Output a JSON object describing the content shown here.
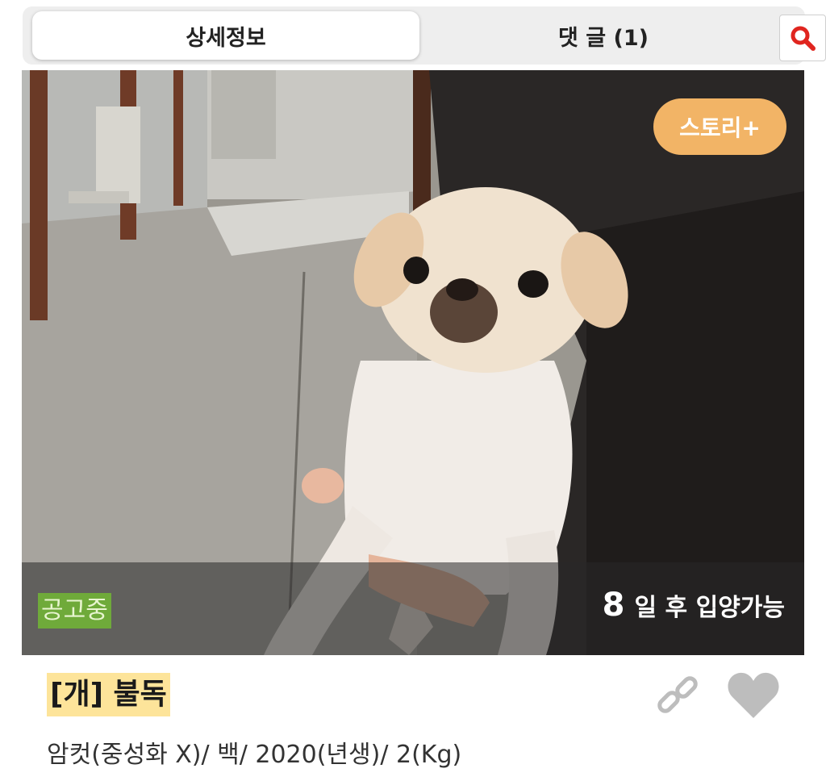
{
  "tabs": {
    "detail_label": "상세정보",
    "comments_label": "댓 글 (1)"
  },
  "icons": {
    "search": "search-icon",
    "link": "link-icon",
    "heart": "heart-icon"
  },
  "photo": {
    "story_button_label": "스토리+",
    "status_badge": "공고중",
    "adopt_days": "8",
    "adopt_label": "일 후 입양가능"
  },
  "animal": {
    "title": "[개] 불독",
    "details": "암컷(중성화 X)/ 백/ 2020(년생)/ 2(Kg)"
  },
  "colors": {
    "search_red": "#e0251f",
    "story_orange": "#f2b466",
    "status_green": "#6faa3a",
    "title_highlight": "#fde49a"
  }
}
